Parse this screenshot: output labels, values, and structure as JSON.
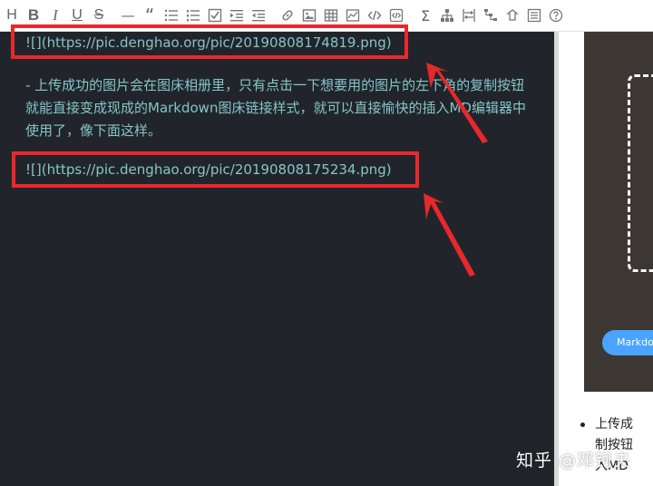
{
  "toolbar": {
    "items": [
      {
        "name": "heading-button",
        "glyph": "H"
      },
      {
        "name": "bold-button",
        "glyph": "B"
      },
      {
        "name": "italic-button",
        "glyph": "I"
      },
      {
        "name": "underline-button",
        "glyph": "U"
      },
      {
        "name": "strikethrough-button",
        "glyph": "S"
      },
      {
        "name": "horizontal-rule-button",
        "glyph": "—"
      },
      {
        "name": "quote-button",
        "glyph": "“"
      }
    ],
    "icons": [
      "unordered-list-icon",
      "ordered-list-icon",
      "task-list-icon",
      "indent-icon",
      "outdent-icon",
      "link-icon",
      "image-icon",
      "table-icon",
      "chart-icon",
      "code-icon",
      "code-block-icon",
      "formula-icon",
      "flowchart-icon",
      "sequence-icon",
      "mermaid-icon",
      "upload-icon",
      "toc-icon",
      "help-icon"
    ]
  },
  "editor": {
    "line1": "![](https://pic.denghao.org/pic/20190808174819.png)",
    "paragraph": "- 上传成功的图片会在图床相册里，只有点击一下想要用的图片的左下角的复制按钮就能直接变成现成的Markdown图床链接样式，就可以直接愉快的插入MD编辑器中使用了，像下面这样。",
    "line2": "![](https://pic.denghao.org/pic/20190808175234.png)"
  },
  "preview": {
    "pill_text": "Markdown",
    "bullet_lines": [
      "上传成",
      "制按钮",
      "入MD"
    ]
  },
  "watermark": "知乎 @邓钶夫",
  "colors": {
    "editor_bg": "#21252b",
    "editor_text": "#84c5c8",
    "highlight": "#e8282b",
    "pill": "#4aa3ff"
  }
}
